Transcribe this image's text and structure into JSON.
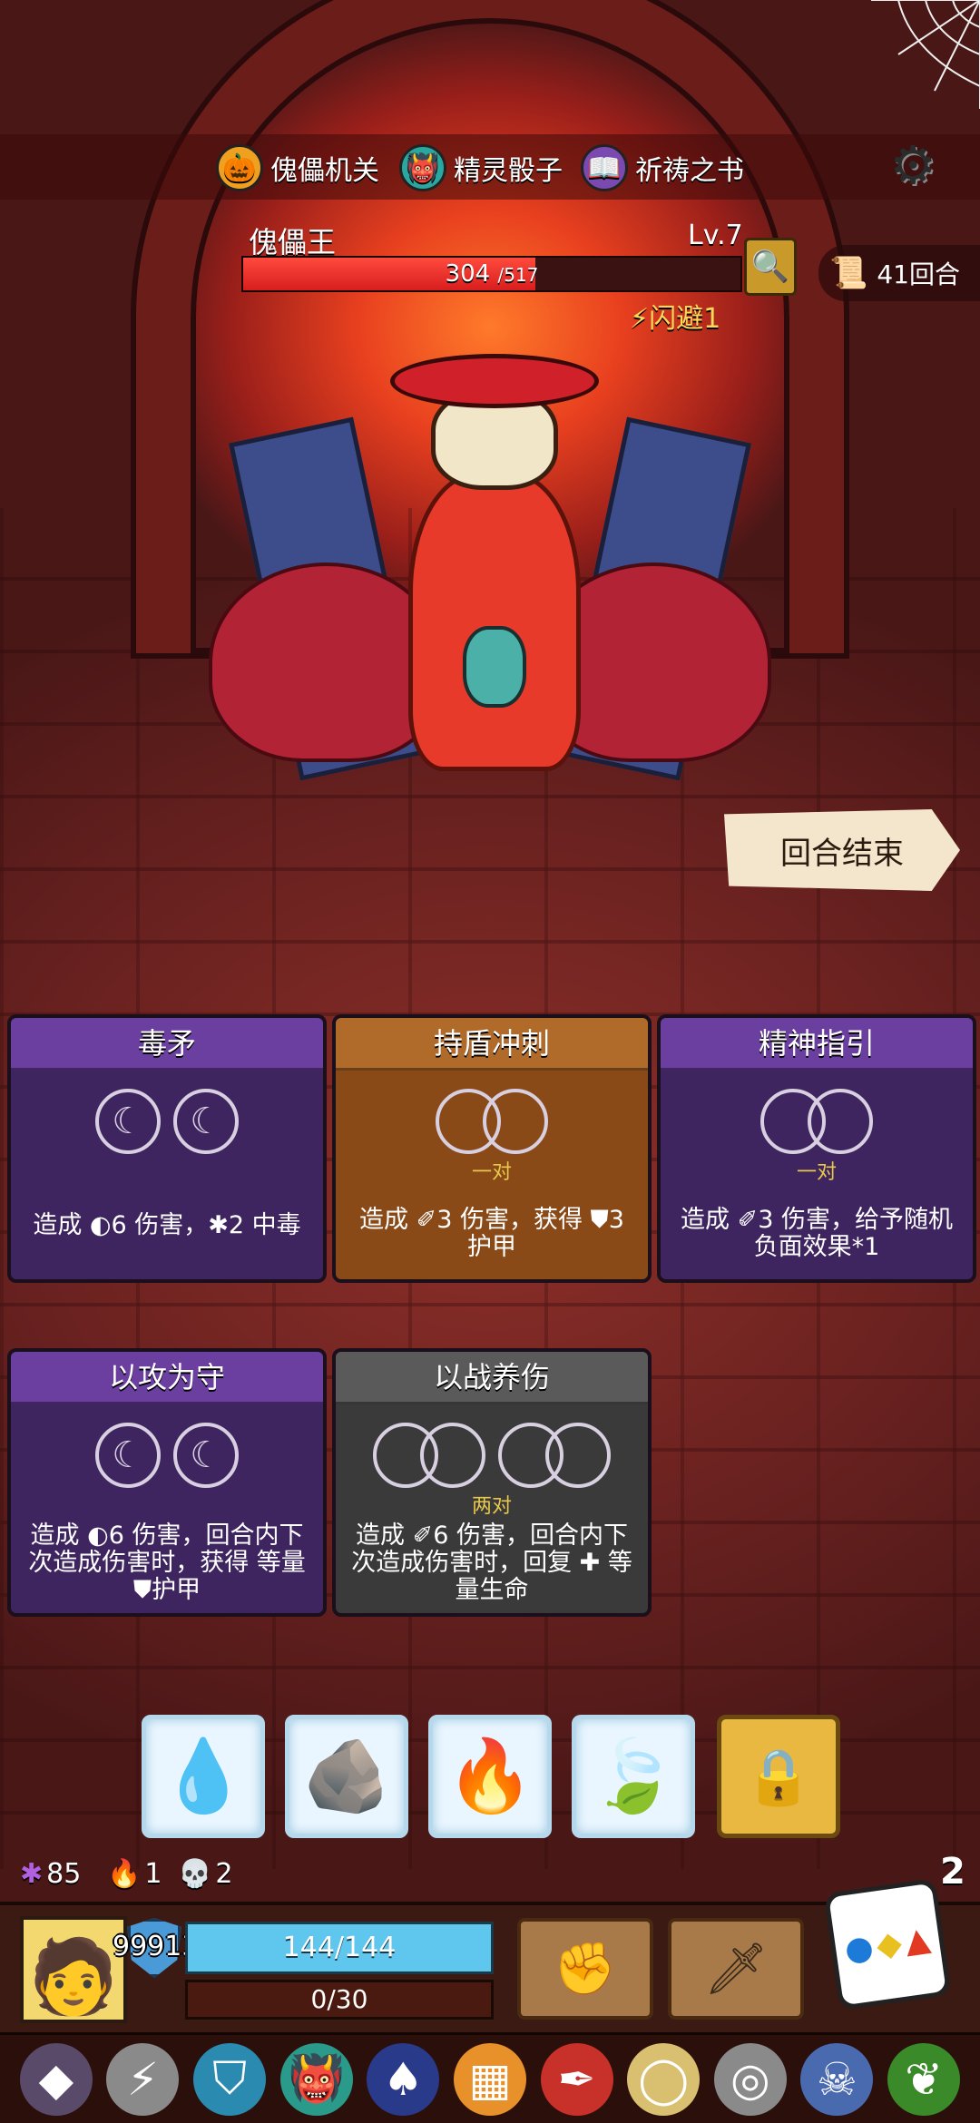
{
  "relics_top": [
    {
      "label": "傀儡机关",
      "icon": "pumpkin-mask-icon",
      "glyph": "🎃"
    },
    {
      "label": "精灵骰子",
      "icon": "spirit-dice-icon",
      "glyph": "👹"
    },
    {
      "label": "祈祷之书",
      "icon": "prayer-book-icon",
      "glyph": "📖"
    }
  ],
  "boss": {
    "name": "傀儡王",
    "level": "Lv.7",
    "hp_current": "304",
    "hp_max": "/517",
    "hp_fraction": 0.588,
    "status": "闪避1"
  },
  "round": {
    "text": "41回合"
  },
  "end_turn": {
    "label": "回合结束"
  },
  "cards": [
    {
      "title": "毒矛",
      "req": "",
      "desc": "造成 ◐6 伤害，✱2 中毒",
      "slots": 2
    },
    {
      "title": "持盾冲刺",
      "req": "一对",
      "desc": "造成 ✐3 伤害，获得 ⛊3 护甲",
      "slots": 1
    },
    {
      "title": "精神指引",
      "req": "一对",
      "desc": "造成 ✐3 伤害，给予随机负面效果*1",
      "slots": 1
    },
    {
      "title": "以攻为守",
      "req": "",
      "desc": "造成 ◐6 伤害，回合内下次造成伤害时，获得 等量 ⛊护甲",
      "slots": 2
    },
    {
      "title": "以战养伤",
      "req": "两对",
      "desc": "造成 ✐6 伤害，回合内下次造成伤害时，回复 ✚ 等量生命",
      "slots": 2
    }
  ],
  "dice_tray": [
    {
      "icon": "water-drop-icon",
      "glyph": "💧"
    },
    {
      "icon": "earth-rock-icon",
      "glyph": "🪨"
    },
    {
      "icon": "fire-icon",
      "glyph": "🔥"
    },
    {
      "icon": "leaf-icon",
      "glyph": "🍃"
    }
  ],
  "status": {
    "poison": "85",
    "burn": "1",
    "skull": "2"
  },
  "dice_count": "2",
  "player": {
    "armor": "99913",
    "hp": "144/144",
    "xp": "0/30"
  },
  "colors": {
    "hp_red": "#e22a22",
    "player_hp_blue": "#5fc6ee",
    "card_purple": "#6b3fa0",
    "card_orange": "#b06a2a",
    "card_grey": "#5a5a5a",
    "status_yellow": "#ffd85a"
  }
}
